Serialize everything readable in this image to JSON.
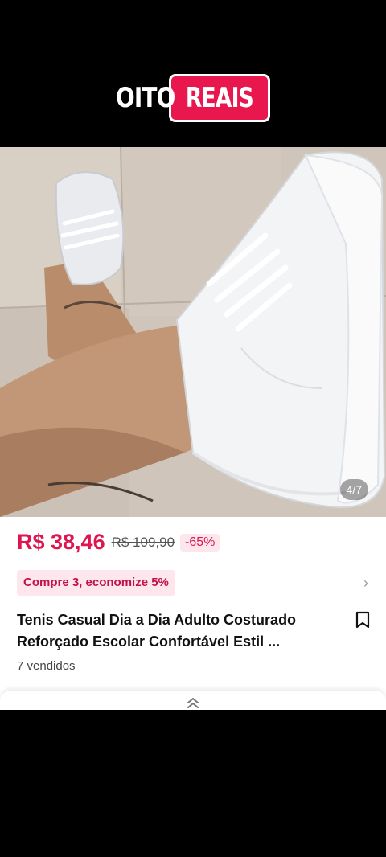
{
  "logo": {
    "left": "OITO",
    "right": "REAIS"
  },
  "gallery": {
    "counter": "4/7",
    "image": "white-sneakers-on-tiled-floor"
  },
  "product": {
    "price": "R$ 38,46",
    "old_price": "R$ 109,90",
    "discount": "-65%",
    "promo": "Compre 3, economize 5%",
    "title": "Tenis Casual Dia a Dia Adulto Costurado Reforçado Escolar Confortável Estil ...",
    "sold": "7 vendidos"
  },
  "colors": {
    "accent": "#e0144f",
    "promo_bg": "#fde6ec"
  }
}
